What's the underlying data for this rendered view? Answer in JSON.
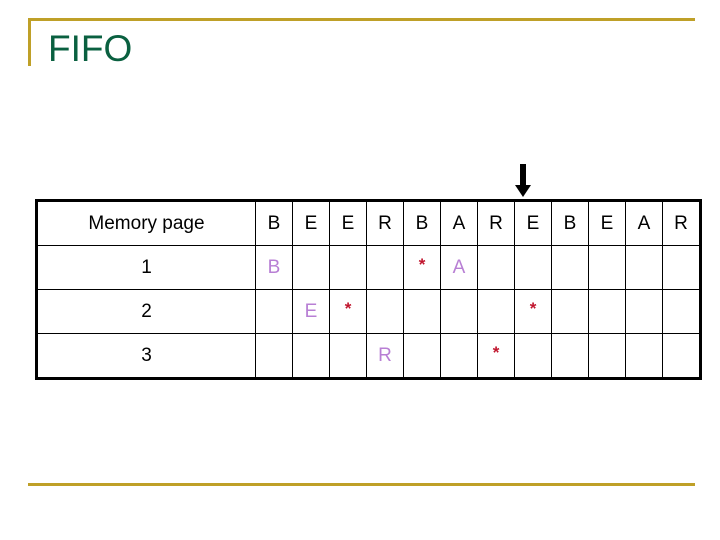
{
  "slide": {
    "title": "FIFO",
    "title_color": "#0a6040",
    "accent_color": "#bfa028"
  },
  "pointer": {
    "icon": "down-arrow-icon",
    "color": "#000000",
    "target_column_index": 8
  },
  "table": {
    "label_header": "Memory page",
    "reference_string": [
      "B",
      "E",
      "E",
      "R",
      "B",
      "A",
      "R",
      "E",
      "B",
      "E",
      "A",
      "R"
    ],
    "letter_color": "#b87fd4",
    "star_color": "#c0142c",
    "rows": [
      {
        "label": "1",
        "cells": [
          "B",
          "",
          "",
          "",
          "*",
          "A",
          "",
          "",
          "",
          "",
          "",
          ""
        ]
      },
      {
        "label": "2",
        "cells": [
          "",
          "E",
          "*",
          "",
          "",
          "",
          "",
          "*",
          "",
          "",
          "",
          ""
        ]
      },
      {
        "label": "3",
        "cells": [
          "",
          "",
          "",
          "R",
          "",
          "",
          "*",
          "",
          "",
          "",
          "",
          ""
        ]
      }
    ]
  }
}
